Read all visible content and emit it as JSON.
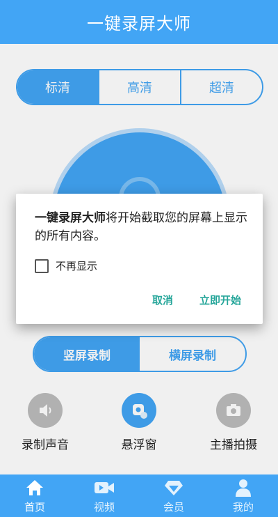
{
  "header": {
    "title": "一键录屏大师"
  },
  "quality": {
    "options": [
      "标清",
      "高清",
      "超清"
    ]
  },
  "dialog": {
    "app_name": "一键录屏大师",
    "message": "将开始截取您的屏幕上显示的所有内容。",
    "checkbox_label": "不再显示",
    "cancel_label": "取消",
    "start_label": "立即开始"
  },
  "orientation": {
    "options": [
      "竖屏录制",
      "横屏录制"
    ]
  },
  "tools": [
    {
      "label": "录制声音",
      "icon": "speaker-icon"
    },
    {
      "label": "悬浮窗",
      "icon": "floating-window-icon"
    },
    {
      "label": "主播拍摄",
      "icon": "camera-icon"
    }
  ],
  "nav": [
    {
      "label": "首页",
      "icon": "home-icon"
    },
    {
      "label": "视频",
      "icon": "video-icon"
    },
    {
      "label": "会员",
      "icon": "diamond-icon"
    },
    {
      "label": "我的",
      "icon": "person-icon"
    }
  ],
  "colors": {
    "primary": "#42A5F5",
    "dialog_button": "#26A69A",
    "inactive_tool": "#BDBDBD"
  }
}
